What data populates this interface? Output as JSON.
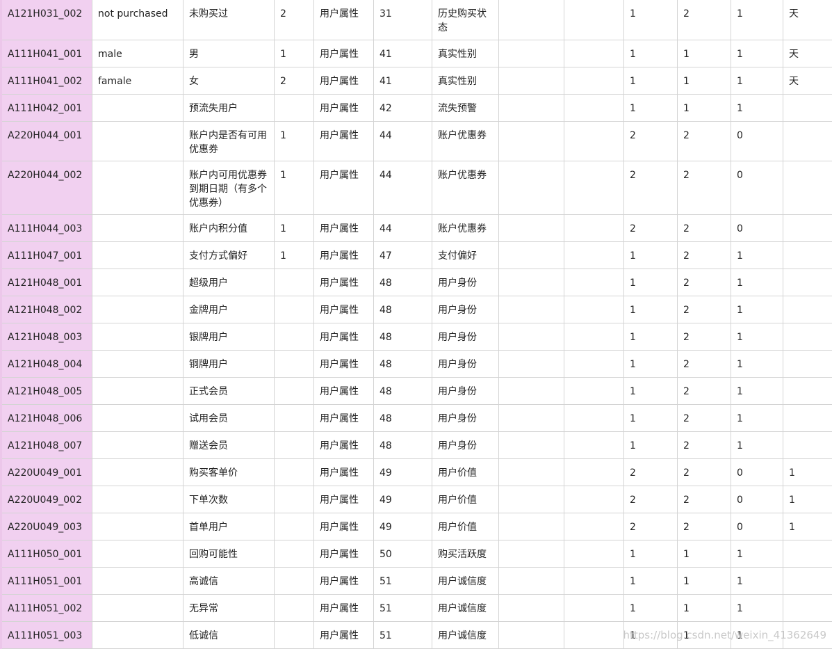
{
  "table": {
    "rows": [
      {
        "code": "A121H031_002",
        "en": "not purchased",
        "name": "未购买过",
        "val": "2",
        "type": "用户属性",
        "num": "31",
        "cat": "历史购买状态",
        "e1": "",
        "e2": "",
        "a": "1",
        "b": "2",
        "c": "1",
        "d": "天"
      },
      {
        "code": "A111H041_001",
        "en": "male",
        "name": "男",
        "val": "1",
        "type": "用户属性",
        "num": "41",
        "cat": "真实性别",
        "e1": "",
        "e2": "",
        "a": "1",
        "b": "1",
        "c": "1",
        "d": "天"
      },
      {
        "code": "A111H041_002",
        "en": "famale",
        "name": "女",
        "val": "2",
        "type": "用户属性",
        "num": "41",
        "cat": "真实性别",
        "e1": "",
        "e2": "",
        "a": "1",
        "b": "1",
        "c": "1",
        "d": "天"
      },
      {
        "code": "A111H042_001",
        "en": "",
        "name": "预流失用户",
        "val": "",
        "type": "用户属性",
        "num": "42",
        "cat": "流失预警",
        "e1": "",
        "e2": "",
        "a": "1",
        "b": "1",
        "c": "1",
        "d": ""
      },
      {
        "code": "A220H044_001",
        "en": "",
        "name": "账户内是否有可用优惠券",
        "val": "1",
        "type": "用户属性",
        "num": "44",
        "cat": "账户优惠券",
        "e1": "",
        "e2": "",
        "a": "2",
        "b": "2",
        "c": "0",
        "d": ""
      },
      {
        "code": "A220H044_002",
        "en": "",
        "name": "账户内可用优惠券到期日期（有多个优惠券）",
        "val": "1",
        "type": "用户属性",
        "num": "44",
        "cat": "账户优惠券",
        "e1": "",
        "e2": "",
        "a": "2",
        "b": "2",
        "c": "0",
        "d": ""
      },
      {
        "code": "A111H044_003",
        "en": "",
        "name": "账户内积分值",
        "val": "1",
        "type": "用户属性",
        "num": "44",
        "cat": "账户优惠券",
        "e1": "",
        "e2": "",
        "a": "2",
        "b": "2",
        "c": "0",
        "d": ""
      },
      {
        "code": "A111H047_001",
        "en": "",
        "name": "支付方式偏好",
        "val": "1",
        "type": "用户属性",
        "num": "47",
        "cat": "支付偏好",
        "e1": "",
        "e2": "",
        "a": "1",
        "b": "2",
        "c": "1",
        "d": ""
      },
      {
        "code": "A121H048_001",
        "en": "",
        "name": "超级用户",
        "val": "",
        "type": "用户属性",
        "num": "48",
        "cat": "用户身份",
        "e1": "",
        "e2": "",
        "a": "1",
        "b": "2",
        "c": "1",
        "d": ""
      },
      {
        "code": "A121H048_002",
        "en": "",
        "name": "金牌用户",
        "val": "",
        "type": "用户属性",
        "num": "48",
        "cat": "用户身份",
        "e1": "",
        "e2": "",
        "a": "1",
        "b": "2",
        "c": "1",
        "d": ""
      },
      {
        "code": "A121H048_003",
        "en": "",
        "name": "银牌用户",
        "val": "",
        "type": "用户属性",
        "num": "48",
        "cat": "用户身份",
        "e1": "",
        "e2": "",
        "a": "1",
        "b": "2",
        "c": "1",
        "d": ""
      },
      {
        "code": "A121H048_004",
        "en": "",
        "name": "铜牌用户",
        "val": "",
        "type": "用户属性",
        "num": "48",
        "cat": "用户身份",
        "e1": "",
        "e2": "",
        "a": "1",
        "b": "2",
        "c": "1",
        "d": ""
      },
      {
        "code": "A121H048_005",
        "en": "",
        "name": "正式会员",
        "val": "",
        "type": "用户属性",
        "num": "48",
        "cat": "用户身份",
        "e1": "",
        "e2": "",
        "a": "1",
        "b": "2",
        "c": "1",
        "d": ""
      },
      {
        "code": "A121H048_006",
        "en": "",
        "name": "试用会员",
        "val": "",
        "type": "用户属性",
        "num": "48",
        "cat": "用户身份",
        "e1": "",
        "e2": "",
        "a": "1",
        "b": "2",
        "c": "1",
        "d": ""
      },
      {
        "code": "A121H048_007",
        "en": "",
        "name": "赠送会员",
        "val": "",
        "type": "用户属性",
        "num": "48",
        "cat": "用户身份",
        "e1": "",
        "e2": "",
        "a": "1",
        "b": "2",
        "c": "1",
        "d": ""
      },
      {
        "code": "A220U049_001",
        "en": "",
        "name": "购买客单价",
        "val": "",
        "type": "用户属性",
        "num": "49",
        "cat": "用户价值",
        "e1": "",
        "e2": "",
        "a": "2",
        "b": "2",
        "c": "0",
        "d": "1"
      },
      {
        "code": "A220U049_002",
        "en": "",
        "name": "下单次数",
        "val": "",
        "type": "用户属性",
        "num": "49",
        "cat": "用户价值",
        "e1": "",
        "e2": "",
        "a": "2",
        "b": "2",
        "c": "0",
        "d": "1"
      },
      {
        "code": "A220U049_003",
        "en": "",
        "name": "首单用户",
        "val": "",
        "type": "用户属性",
        "num": "49",
        "cat": "用户价值",
        "e1": "",
        "e2": "",
        "a": "2",
        "b": "2",
        "c": "0",
        "d": "1"
      },
      {
        "code": "A111H050_001",
        "en": "",
        "name": "回购可能性",
        "val": "",
        "type": "用户属性",
        "num": "50",
        "cat": "购买活跃度",
        "e1": "",
        "e2": "",
        "a": "1",
        "b": "1",
        "c": "1",
        "d": ""
      },
      {
        "code": "A111H051_001",
        "en": "",
        "name": "高诚信",
        "val": "",
        "type": "用户属性",
        "num": "51",
        "cat": "用户诚信度",
        "e1": "",
        "e2": "",
        "a": "1",
        "b": "1",
        "c": "1",
        "d": ""
      },
      {
        "code": "A111H051_002",
        "en": "",
        "name": "无异常",
        "val": "",
        "type": "用户属性",
        "num": "51",
        "cat": "用户诚信度",
        "e1": "",
        "e2": "",
        "a": "1",
        "b": "1",
        "c": "1",
        "d": ""
      },
      {
        "code": "A111H051_003",
        "en": "",
        "name": "低诚信",
        "val": "",
        "type": "用户属性",
        "num": "51",
        "cat": "用户诚信度",
        "e1": "",
        "e2": "",
        "a": "1",
        "b": "1",
        "c": "1",
        "d": ""
      }
    ]
  },
  "watermark": "https://blog.csdn.net/weixin_41362649",
  "colors": {
    "id_column_bg": "#f1d0f0",
    "border": "#d4d4d4",
    "text": "#222222"
  }
}
